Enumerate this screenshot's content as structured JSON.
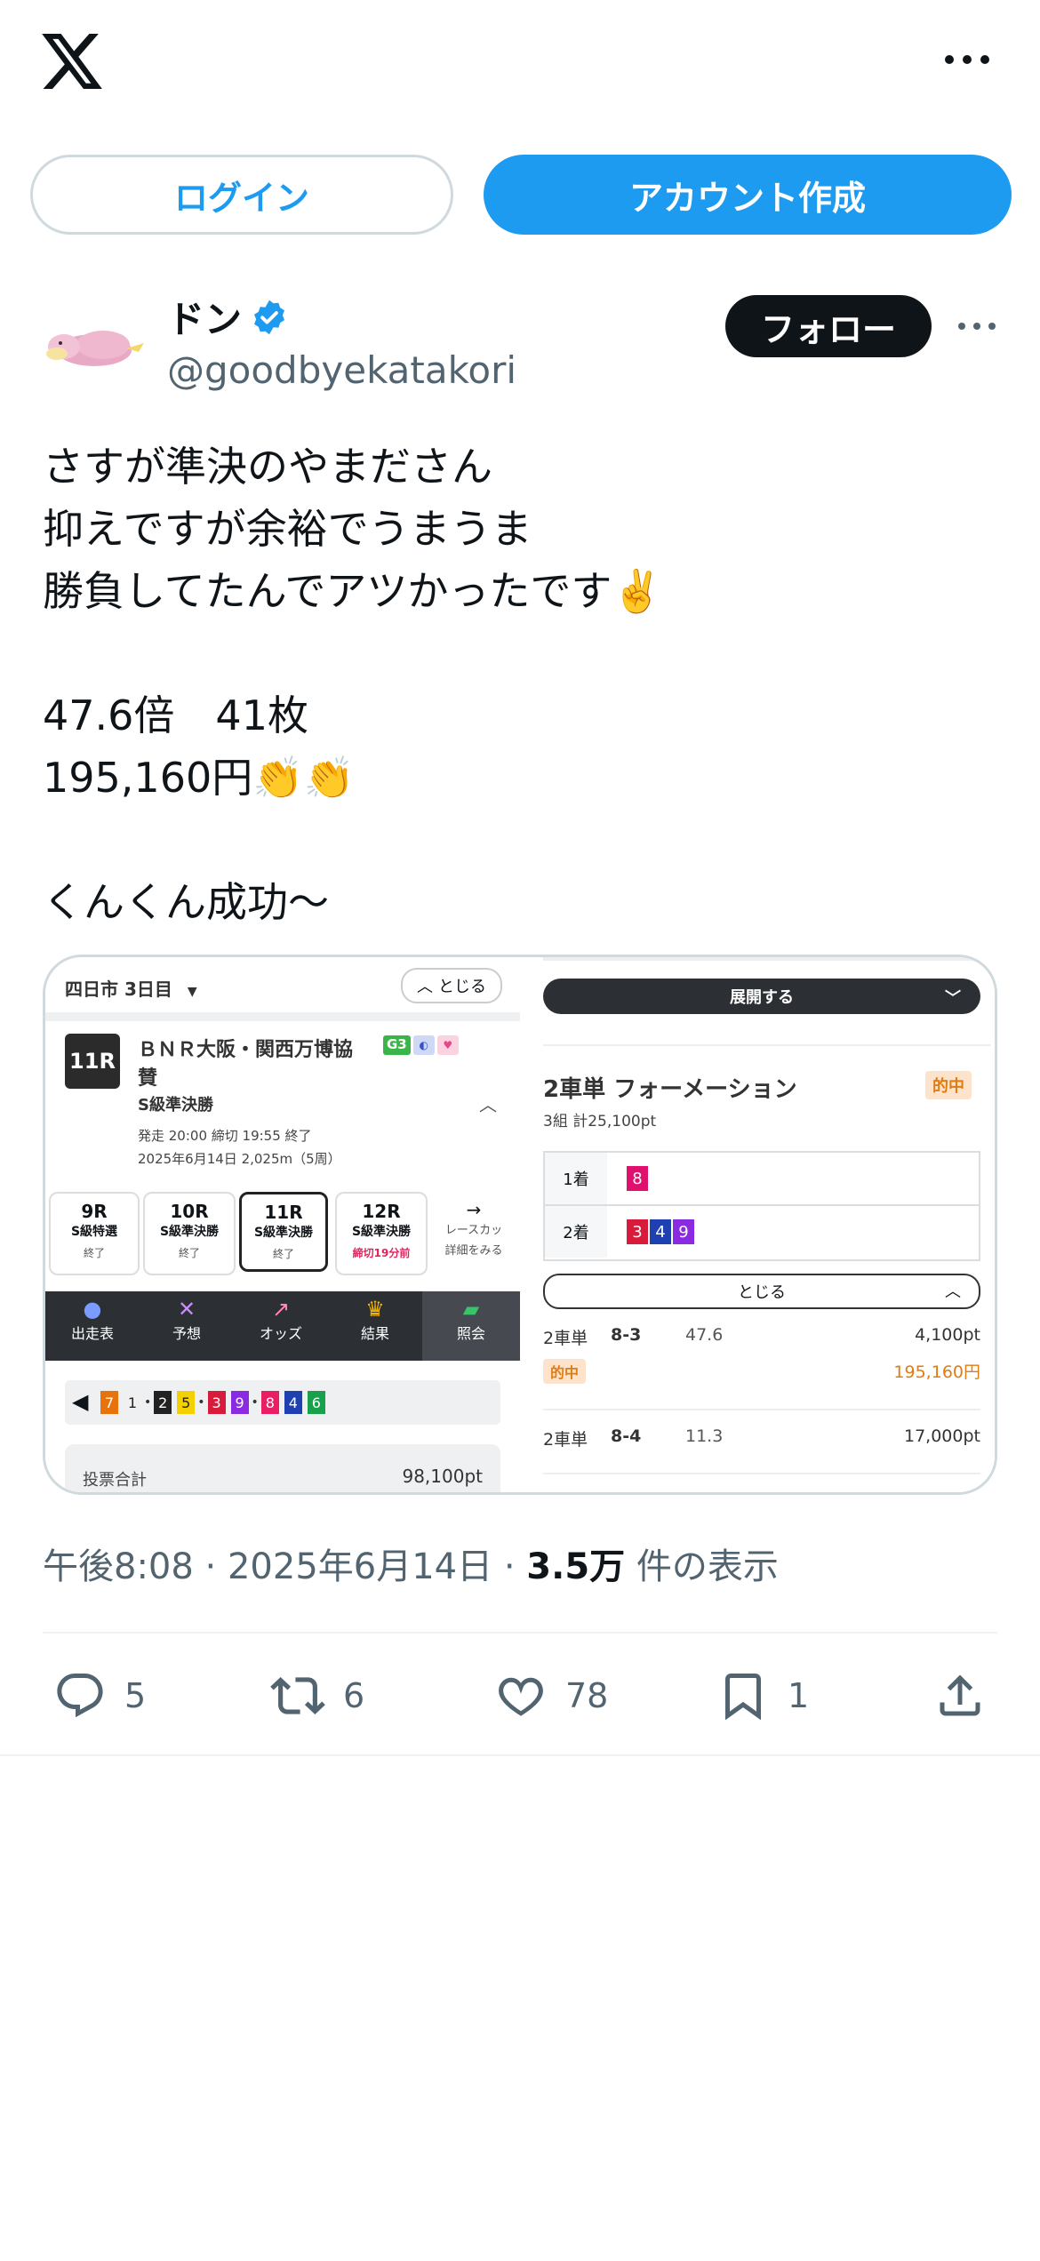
{
  "header": {
    "logo_icon": "x-logo-icon",
    "more_icon": "more-horizontal-icon"
  },
  "auth": {
    "login_label": "ログイン",
    "signup_label": "アカウント作成"
  },
  "author": {
    "display_name": "ドン",
    "handle": "@goodbyekatakori",
    "verified_icon": "verified-badge-icon",
    "follow_label": "フォロー"
  },
  "tweet": {
    "lines": [
      "さすが準決のやまださん",
      "抑えですが余裕でうまうま",
      "勝負してたんでアツかったです✌️",
      "",
      "47.6倍　41枚",
      "195,160円👏👏",
      "",
      "くんくん成功〜"
    ]
  },
  "media": {
    "left": {
      "venue": "四日市 3日目",
      "close_label": "とじる",
      "race_no": "11R",
      "race_title_1": "ＢＮＲ大阪・関西万博協",
      "race_title_2": "賛",
      "grade": "G3",
      "race_class": "S級準決勝",
      "race_time": "発走 20:00 締切 19:55  終了",
      "race_date": "2025年6月14日 2,025m（5周）",
      "race_tabs": [
        {
          "no": "9R",
          "cls": "S級特選",
          "status": "終了"
        },
        {
          "no": "10R",
          "cls": "S級準決勝",
          "status": "終了"
        },
        {
          "no": "11R",
          "cls": "S級準決勝",
          "status": "終了"
        },
        {
          "no": "12R",
          "cls": "S級準決勝",
          "status": "締切19分前"
        },
        {
          "no": "→",
          "cls": "レースカッ",
          "status": "詳細をみる"
        }
      ],
      "nav": [
        {
          "label": "出走表",
          "icon": "person-icon"
        },
        {
          "label": "予想",
          "icon": "prediction-icon"
        },
        {
          "label": "オッズ",
          "icon": "chart-icon"
        },
        {
          "label": "結果",
          "icon": "trophy-icon"
        },
        {
          "label": "照会",
          "icon": "ticket-icon"
        }
      ],
      "lineup": [
        "7",
        "1",
        "2",
        "5",
        "3",
        "9",
        "8",
        "4",
        "6"
      ],
      "lineup_colors": [
        "#e8730c",
        "#f0f0f0",
        "#222222",
        "#f5d000",
        "#d81b3b",
        "#8a2be2",
        "#e91e63",
        "#1e40b0",
        "#18a04a"
      ],
      "bet_total_label": "投票合計",
      "bet_total_value": "98,100pt"
    },
    "right": {
      "expand_label": "展開する",
      "bet_type": "2車単 フォーメーション",
      "hit_badge": "的中",
      "bet_sub": "3組 計25,100pt",
      "first_label": "1着",
      "first_nums": [
        "8"
      ],
      "second_label": "2着",
      "second_nums": [
        "3",
        "4",
        "9"
      ],
      "close_label": "とじる",
      "rows": [
        {
          "type": "2車単",
          "combo": "8-3",
          "odds": "47.6",
          "amount": "4,100pt",
          "hit": "的中",
          "payout": "195,160円"
        },
        {
          "type": "2車単",
          "combo": "8-4",
          "odds": "11.3",
          "amount": "17,000pt"
        }
      ]
    }
  },
  "meta": {
    "time": "午後8:08",
    "date": "2025年6月14日",
    "views": "3.5万",
    "views_suffix": "件の表示"
  },
  "stats": {
    "replies": "5",
    "retweets": "6",
    "likes": "78",
    "bookmarks": "1"
  },
  "colors": {
    "accent": "#1d9bf0",
    "text": "#0f1419",
    "muted": "#536471"
  }
}
